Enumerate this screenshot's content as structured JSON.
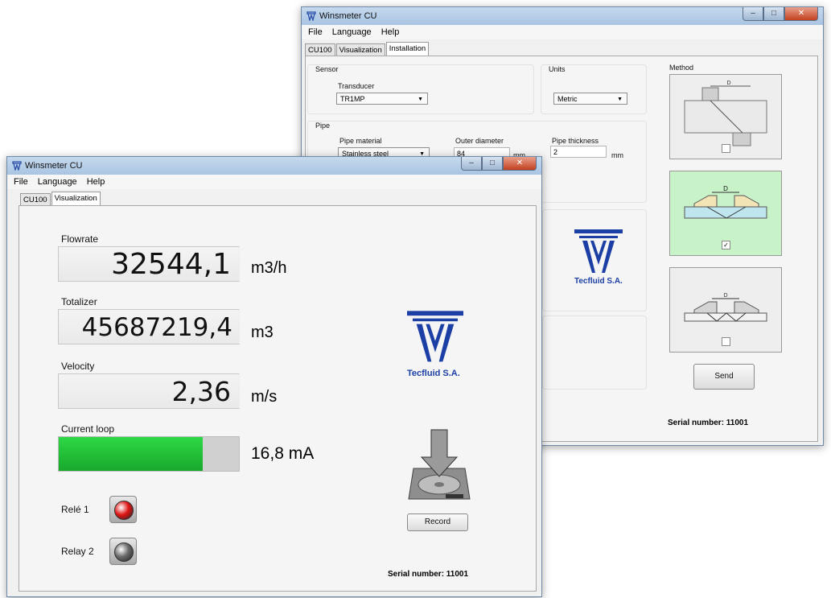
{
  "back_window": {
    "title": "Winsmeter CU",
    "menu": [
      "File",
      "Language",
      "Help"
    ],
    "tabs": [
      "CU100",
      "Visualization",
      "Installation"
    ],
    "active_tab": "Installation",
    "sensor": {
      "group_label": "Sensor",
      "transducer_label": "Transducer",
      "transducer_value": "TR1MP"
    },
    "units": {
      "group_label": "Units",
      "value": "Metric"
    },
    "pipe": {
      "group_label": "Pipe",
      "material_label": "Pipe material",
      "material_value": "Stainless steel",
      "outer_diameter_label": "Outer diameter",
      "outer_diameter_value": "84",
      "outer_diameter_unit": "mm",
      "thickness_label": "Pipe thickness",
      "thickness_value": "2",
      "thickness_unit": "mm"
    },
    "logo_text": "Tecfluid S.A.",
    "method": {
      "label": "Method",
      "options": [
        {
          "mark": "D",
          "checked": false
        },
        {
          "mark": "D",
          "checked": true
        },
        {
          "mark": "D",
          "checked": false
        }
      ]
    },
    "send_label": "Send",
    "serial": "Serial number: 11001",
    "colors": {
      "selected_method": "#c8f2c8",
      "pipe_fill": "#bfe6ee",
      "transducer_fill": "#f2e4b5"
    }
  },
  "front_window": {
    "title": "Winsmeter CU",
    "menu": [
      "File",
      "Language",
      "Help"
    ],
    "tabs": [
      "CU100",
      "Visualization"
    ],
    "active_tab": "Visualization",
    "flowrate": {
      "label": "Flowrate",
      "value": "32544,1",
      "unit": "m3/h"
    },
    "totalizer": {
      "label": "Totalizer",
      "value": "45687219,4",
      "unit": "m3"
    },
    "velocity": {
      "label": "Velocity",
      "value": "2,36",
      "unit": "m/s"
    },
    "current_loop": {
      "label": "Current loop",
      "reading": "16,8 mA",
      "fill_percent": 80
    },
    "relays": [
      {
        "label": "Relé 1",
        "state": "on",
        "color": "#e01515"
      },
      {
        "label": "Relay 2",
        "state": "off",
        "color": "#6a6a6a"
      }
    ],
    "logo_text": "Tecfluid S.A.",
    "record_label": "Record",
    "serial": "Serial number: 11001",
    "colors": {
      "progress": "#1fbf35",
      "logo_blue": "#1b3fa5"
    }
  }
}
